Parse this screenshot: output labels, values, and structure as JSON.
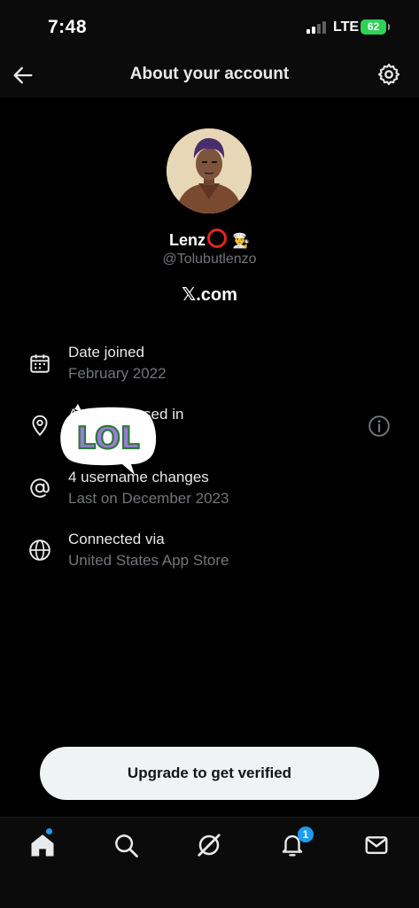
{
  "status_bar": {
    "time": "7:48",
    "network": "LTE",
    "battery": "62"
  },
  "header": {
    "title": "About your account",
    "back_icon": "arrow-left-icon",
    "settings_icon": "gear-icon"
  },
  "profile": {
    "display_name": "Lenz",
    "handle": "@Tolubutlenzo",
    "site": "𝕏.com",
    "name_emoji": "👨‍🍳"
  },
  "rows": [
    {
      "icon": "calendar-icon",
      "title": "Date joined",
      "subtitle": "February 2022"
    },
    {
      "icon": "location-pin-icon",
      "title": "Account based in",
      "subtitle": ""
    },
    {
      "icon": "at-sign-icon",
      "title": "4 username changes",
      "subtitle": "Last on December 2023"
    },
    {
      "icon": "globe-icon",
      "title": "Connected via",
      "subtitle": "United States App Store"
    }
  ],
  "sticker": {
    "text": "LOL"
  },
  "upgrade": {
    "label": "Upgrade to get verified"
  },
  "tabbar": {
    "notifications_badge": "1",
    "items": [
      "home-icon",
      "search-icon",
      "grok-icon",
      "bell-icon",
      "mail-icon"
    ]
  },
  "colors": {
    "background": "#000000",
    "accent": "#1d9bf0",
    "secondary_text": "#71767b",
    "battery": "#30d158"
  }
}
